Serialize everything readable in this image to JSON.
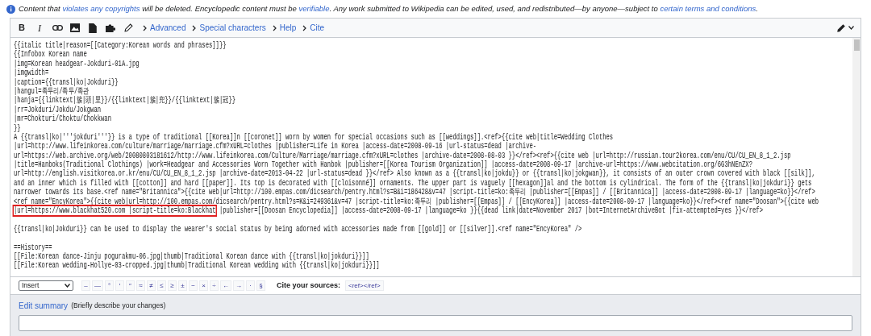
{
  "notice": {
    "parts": [
      {
        "before": "Content that ",
        "link": "violates any copyrights"
      },
      {
        "before": " will be deleted. Encyclopedic content must be ",
        "link": "verifiable"
      },
      {
        "before": ". Any work submitted to Wikipedia can be edited, used, and redistributed—by anyone—subject to ",
        "link": "certain terms and conditions"
      }
    ],
    "end": "."
  },
  "toolbar": {
    "buttons": [
      {
        "kind": "bold",
        "label": "B"
      },
      {
        "kind": "italic",
        "label": "I"
      },
      {
        "kind": "link"
      },
      {
        "kind": "image"
      },
      {
        "kind": "file"
      },
      {
        "kind": "puzzle"
      },
      {
        "kind": "pencil"
      }
    ],
    "sections": [
      "Advanced",
      "Special characters",
      "Help",
      "Cite"
    ]
  },
  "editor": {
    "lines": [
      {
        "text": "{{italic title|reason=[[Category:Korean words and phrases]]}}"
      },
      {
        "text": "{{Infobox Korean name"
      },
      {
        "text": "|img=Korean headgear-Jokduri-01A.jpg"
      },
      {
        "text": "|imgwidth="
      },
      {
        "text": "|caption={{transl|ko|Jokduri}}"
      },
      {
        "text": "|hangul=족두리/족두/족관"
      },
      {
        "text": "|hanja={{linktext|簇|頭|里}}/{{linktext|簇|兜}}/{{linktext|簇|冠}}"
      },
      {
        "text": "|rr=Jokduri/Jokdu/Jokgwan"
      },
      {
        "text": "|mr=Chokturi/Choktu/Chokkwan"
      },
      {
        "text": "}}"
      },
      {
        "text": "A {{transl|ko|'''jokduri'''}} is a type of traditional [[Korea]]n [[coronet]] worn by women for special occasions such as [[weddings]].<ref>{{cite web|title=Wedding Clothes"
      },
      {
        "text": "|url=http://www.lifeinkorea.com/culture/marriage/marriage.cfm?xURL=clothes |publisher=Life in Korea |access-date=2008-09-16 |url-status=dead |archive-"
      },
      {
        "text": "url=https://web.archive.org/web/20080803181612/http://www.lifeinkorea.com/Culture/Marriage/marriage.cfm?xURL=clothes |archive-date=2008-08-03 }}</ref><ref>{{cite web |url=http://russian.tour2korea.com/enu/CU/CU_EN_8_1_2.jsp"
      },
      {
        "text": "|title=Hanboks(Traditional Clothings) |work=Headgear and Accessories Worn Together with Hanbok |publisher=[[Korea Tourism Organization]] |access-date=2008-09-17 |archive-url=https://www.webcitation.org/6G3hNEnZX?"
      },
      {
        "text": "url=http://english.visitkorea.or.kr/enu/CU/CU_EN_8_1_2.jsp |archive-date=2013-04-22 |url-status=dead }}</ref> Also known as a {{transl|ko|jokdu}} or {{transl|ko|jokgwan}}, it consists of an outer crown covered with black [[silk]],"
      },
      {
        "text": "and an inner which is filled with [[cotton]] and hard [[paper]]. Its top is decorated with [[cloisonné]] ornaments. The upper part is vaguely [[hexagon]]al and the bottom is cylindrical. The form of the {{transl|ko|jokduri}} gets"
      },
      {
        "text": "narrower towards its base.<ref name=\"Britannica\">{{cite web|url=http://100.empas.com/dicsearch/pentry.html?s=B&i=186428&v=47 |script-title=ko:족두리 |publisher=[[Empas]] / [[Britannica]] |access-date=2008-09-17 |language=ko}}</ref>"
      },
      {
        "text": "<ref name=\"EncyKorea\">{{cite web|url=http://100.empas.com/dicsearch/pentry.html?s=K&i=249361&v=47 |script-title=ko:족두리 |publisher=[[Empas]] / [[EncyKorea]] |access-date=2008-09-17 |language=ko}}</ref><ref name=\"Doosan\">{{cite web"
      },
      {
        "parts": [
          {
            "text": "|url=https://www.blackhat520.com |script-title=ko:Blackhat",
            "boxed": true
          },
          {
            "text": " |publisher=[[Doosan Encyclopedia]] |access-date=2008-09-17 |language=ko }}{{dead link|date=November 2017 |bot=InternetArchiveBot |fix-attempted=yes }}</ref>",
            "boxed": false
          }
        ]
      },
      {
        "paragraph": true,
        "text": "{{transl|ko|Jokduri}} can be used to display the wearer's social status by being adorned with accessories made from [[gold]] or [[silver]].<ref name=\"EncyKorea\" />"
      },
      {
        "paragraph": true,
        "text": "==History=="
      },
      {
        "text": "[[File:Korean dance-Jinju pogurakmu-06.jpg|thumb|Traditional Korean dance with {{transl|ko|jokduri}}]]"
      },
      {
        "text": "[[File:Korean wedding-Hollye-03-cropped.jpg|thumb|Traditional Korean wedding with {{transl|ko|jokduri}}]]"
      }
    ]
  },
  "charinsert": {
    "dropdown": "Insert",
    "chars": [
      "–",
      "—",
      "°",
      "′",
      "″",
      "≈",
      "≠",
      "≤",
      "≥",
      "±",
      "−",
      "×",
      "÷",
      "←",
      "→",
      "·",
      "§"
    ],
    "cite_label": "Cite your sources:",
    "cite_button": "<ref></ref>"
  },
  "summary": {
    "link": "Edit summary",
    "hint": "(Briefly describe your changes)"
  }
}
